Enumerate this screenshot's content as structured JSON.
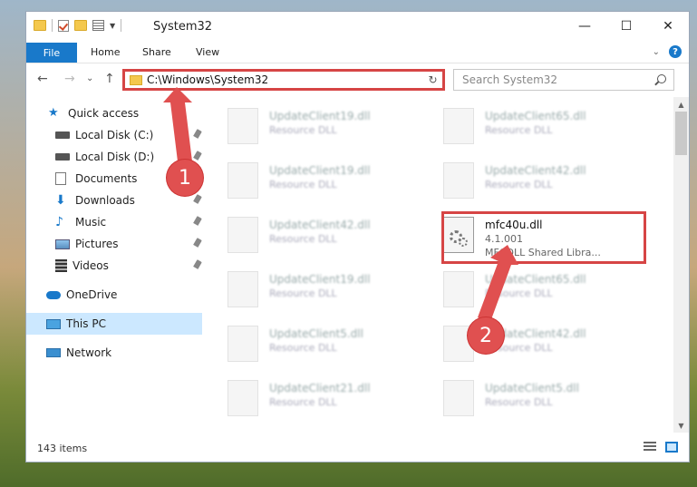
{
  "window": {
    "title": "System32"
  },
  "controls": {
    "minimize": "—",
    "maximize": "☐",
    "close": "✕"
  },
  "ribbon": {
    "file": "File",
    "tabs": [
      "Home",
      "Share",
      "View"
    ],
    "help": "?",
    "expand": "⌄"
  },
  "nav": {
    "back": "←",
    "forward": "→",
    "recent": "⌄",
    "up": "↑"
  },
  "address": {
    "path": "C:\\Windows\\System32",
    "dropdown": "⌄",
    "refresh": "↻"
  },
  "search": {
    "placeholder": "Search System32"
  },
  "sidebar": {
    "items": [
      {
        "label": "Quick access",
        "icon": "star-icon",
        "pinned": false
      },
      {
        "label": "Local Disk (C:)",
        "icon": "drive-icon",
        "pinned": true
      },
      {
        "label": "Local Disk (D:)",
        "icon": "drive-icon",
        "pinned": true
      },
      {
        "label": "Documents",
        "icon": "documents-icon",
        "pinned": true
      },
      {
        "label": "Downloads",
        "icon": "download-icon",
        "pinned": true
      },
      {
        "label": "Music",
        "icon": "music-icon",
        "pinned": true
      },
      {
        "label": "Pictures",
        "icon": "pictures-icon",
        "pinned": true
      },
      {
        "label": "Videos",
        "icon": "videos-icon",
        "pinned": true
      },
      {
        "label": "OneDrive",
        "icon": "cloud-icon",
        "pinned": false
      },
      {
        "label": "This PC",
        "icon": "computer-icon",
        "pinned": false,
        "selected": true
      },
      {
        "label": "Network",
        "icon": "network-icon",
        "pinned": false
      }
    ]
  },
  "files": [
    {
      "name": "UpdateClient19.dll",
      "sub": "Resource DLL"
    },
    {
      "name": "UpdateClient65.dll",
      "sub": "Resource DLL"
    },
    {
      "name": "UpdateClient19.dll",
      "sub": "Resource DLL"
    },
    {
      "name": "UpdateClient42.dll",
      "sub": "Resource DLL"
    },
    {
      "name": "UpdateClient42.dll",
      "sub": "Resource DLL"
    },
    {
      "name": "mfc40u.dll",
      "sub": "4.1.001",
      "sub2": "MFCDLL Shared Libra...",
      "focus": true
    },
    {
      "name": "UpdateClient19.dll",
      "sub": "Resource DLL"
    },
    {
      "name": "UpdateClient65.dll",
      "sub": "Resource DLL"
    },
    {
      "name": "UpdateClient5.dll",
      "sub": "Resource DLL"
    },
    {
      "name": "UpdateClient42.dll",
      "sub": "Resource DLL"
    },
    {
      "name": "UpdateClient21.dll",
      "sub": "Resource DLL"
    },
    {
      "name": "UpdateClient5.dll",
      "sub": "Resource DLL"
    }
  ],
  "status": {
    "count": "143 items"
  },
  "markers": {
    "one": "1",
    "two": "2"
  },
  "colors": {
    "accent": "#1979ca",
    "highlight": "#d64545",
    "selection": "#cce8ff"
  }
}
